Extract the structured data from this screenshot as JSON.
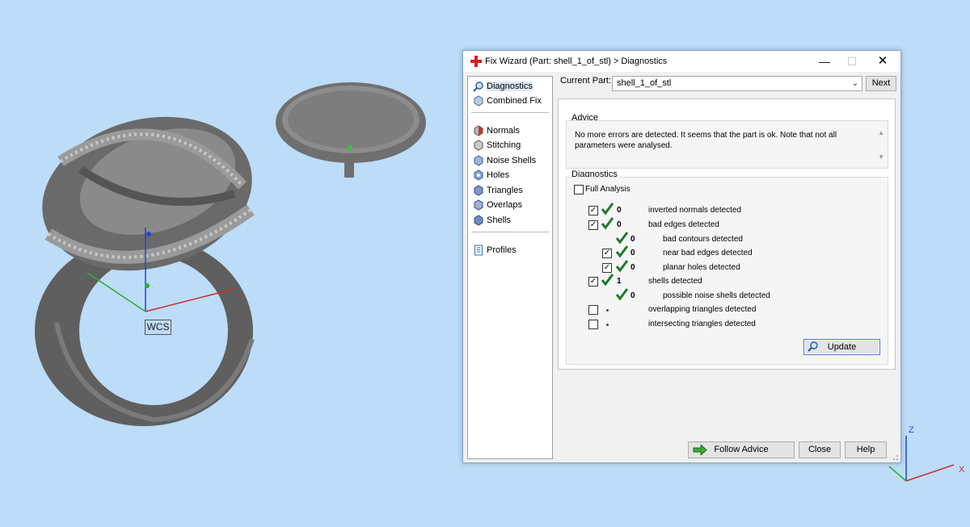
{
  "viewport": {
    "wcs_label": "WCS",
    "triad_z_label": "Z",
    "triad_x_label": "X"
  },
  "dialog": {
    "title": "Fix Wizard (Part: shell_1_of_stl) > Diagnostics",
    "window_buttons": {
      "minimize": "—",
      "maximize": "☐",
      "close": "✕"
    },
    "sidebar": {
      "items_top": [
        "Diagnostics",
        "Combined Fix"
      ],
      "items_tools": [
        "Normals",
        "Stitching",
        "Noise Shells",
        "Holes",
        "Triangles",
        "Overlaps",
        "Shells"
      ],
      "items_bottom": [
        "Profiles"
      ]
    },
    "current_part_label": "Current Part:",
    "current_part_value": "shell_1_of_stl",
    "next_label": "Next",
    "advice_title": "Advice",
    "advice_text": "No more errors are detected. It seems that the part is ok. Note that not all parameters were analysed.",
    "diagnostics_title": "Diagnostics",
    "full_analysis_label": "Full Analysis",
    "rows": [
      {
        "checkbox": "checked",
        "status": "ok",
        "count": "0",
        "label": "inverted normals detected"
      },
      {
        "checkbox": "checked",
        "status": "ok",
        "count": "0",
        "label": "bad edges detected"
      },
      {
        "checkbox": "none",
        "status": "ok",
        "count": "0",
        "label": "bad contours detected"
      },
      {
        "checkbox": "checked",
        "status": "ok",
        "count": "0",
        "label": "near bad edges detected"
      },
      {
        "checkbox": "checked",
        "status": "ok",
        "count": "0",
        "label": "planar holes detected"
      },
      {
        "checkbox": "checked",
        "status": "ok",
        "count": "1",
        "label": "shells detected"
      },
      {
        "checkbox": "none",
        "status": "ok",
        "count": "0",
        "label": "possible noise shells detected"
      },
      {
        "checkbox": "unchecked",
        "status": "not-run",
        "count": "",
        "label": "overlapping triangles detected"
      },
      {
        "checkbox": "unchecked",
        "status": "not-run",
        "count": "",
        "label": "intersecting triangles detected"
      }
    ],
    "update_label": "Update",
    "follow_advice_label": "Follow Advice",
    "close_label": "Close",
    "help_label": "Help"
  },
  "colors": {
    "background": "#bcdcf8",
    "check_green": "#1e7a2a",
    "accent_blue": "#3c7fd4"
  }
}
